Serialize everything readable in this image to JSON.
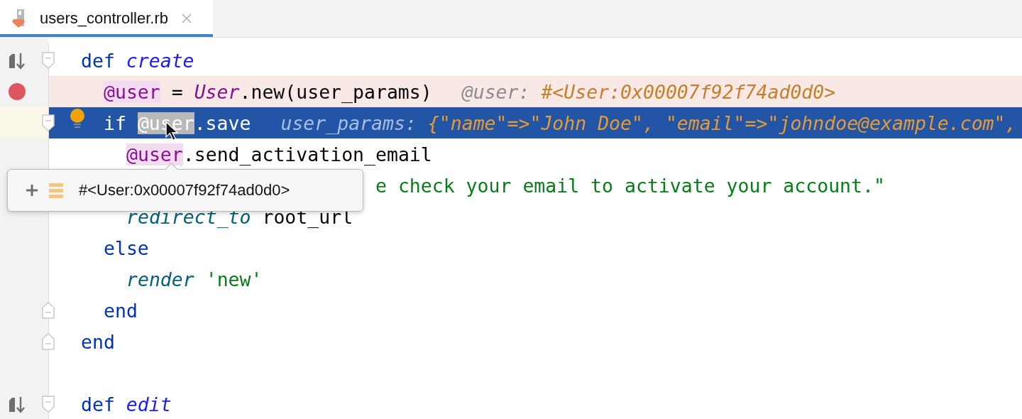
{
  "tabs": [
    {
      "label": "users_controller.rb",
      "selected": true
    }
  ],
  "editor": {
    "lines": [
      {
        "kind": "method_def",
        "segments": [
          {
            "kind": "keyword",
            "text": "def "
          },
          {
            "kind": "method",
            "text": "create"
          }
        ],
        "children": [
          {
            "kind": "breakpoint",
            "segments": [
              {
                "kind": "ivar_highlight",
                "text": "@user"
              },
              {
                "kind": "plain",
                "text": " = "
              },
              {
                "kind": "const",
                "text": "User"
              },
              {
                "kind": "plain",
                "text": ".new(user_params)"
              }
            ],
            "hint": {
              "name": "@user:",
              "value": "#<User:0x00007f92f74ad0d0>"
            }
          },
          {
            "kind": "current",
            "segments": [
              {
                "kind": "keyword",
                "text": "if "
              },
              {
                "kind": "ivar_highlight",
                "text": "@user"
              },
              {
                "kind": "plain",
                "text": ".save"
              }
            ],
            "hint": {
              "name": "user_params:",
              "value": "{\"name\"=>\"John Doe\", \"email\"=>\"johndoe@example.com\","
            },
            "children": [
              {
                "kind": "code",
                "segments": [
                  {
                    "kind": "ivar_highlight",
                    "text": "@user"
                  },
                  {
                    "kind": "plain",
                    "text": ".send_activation_email"
                  }
                ]
              },
              {
                "kind": "covered",
                "segments": [
                  {
                    "kind": "string",
                    "text": "e check your email to activate your account.\""
                  }
                ]
              },
              {
                "kind": "code",
                "segments": [
                  {
                    "kind": "call",
                    "text": "redirect_to"
                  },
                  {
                    "kind": "plain",
                    "text": " root_url"
                  }
                ]
              }
            ]
          },
          {
            "kind": "code",
            "segments": [
              {
                "kind": "keyword",
                "text": "else"
              }
            ],
            "children": [
              {
                "kind": "code",
                "segments": [
                  {
                    "kind": "call",
                    "text": "render"
                  },
                  {
                    "kind": "string",
                    "text": " 'new'"
                  }
                ]
              }
            ]
          },
          {
            "kind": "block_end",
            "segments": [
              {
                "kind": "keyword",
                "text": "end"
              }
            ]
          }
        ]
      },
      {
        "kind": "block_end",
        "segments": [
          {
            "kind": "keyword",
            "text": "end"
          }
        ]
      },
      {
        "kind": "blank"
      },
      {
        "kind": "method_def",
        "segments": [
          {
            "kind": "keyword",
            "text": "def "
          },
          {
            "kind": "method",
            "text": "edit"
          }
        ]
      }
    ]
  },
  "tooltip": {
    "value": "#<User:0x00007f92f74ad0d0>"
  }
}
